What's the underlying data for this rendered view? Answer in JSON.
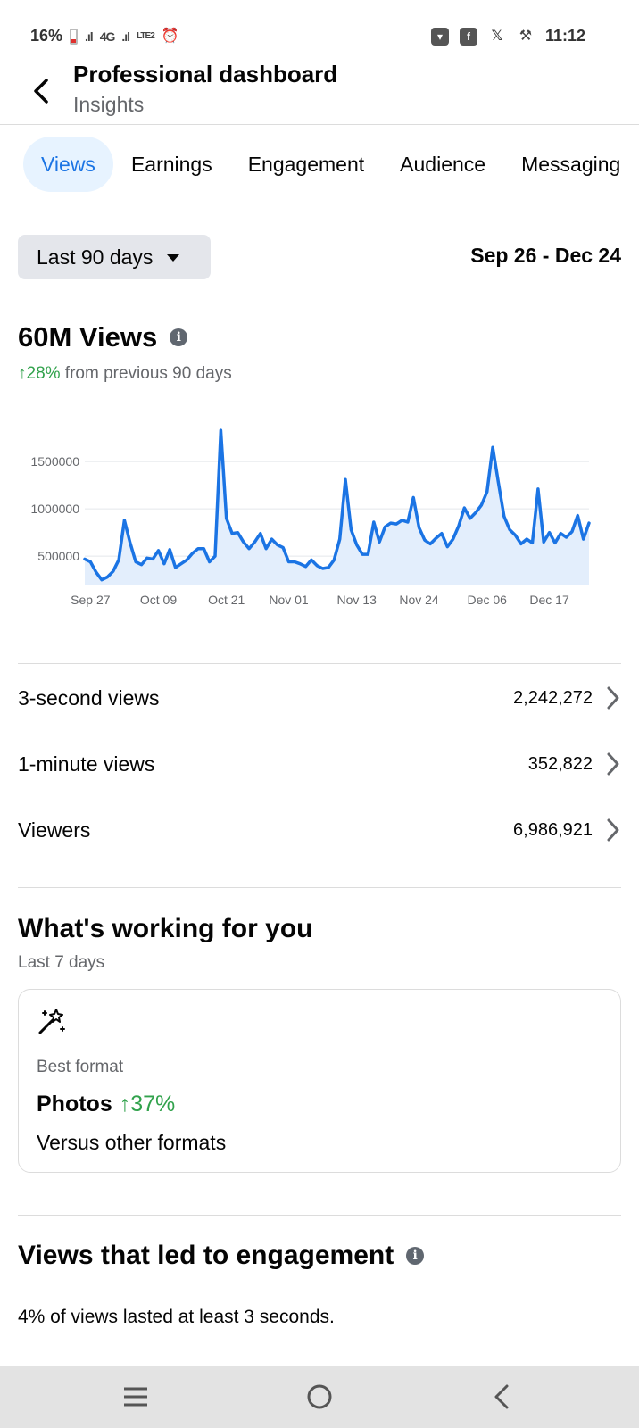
{
  "status_bar": {
    "battery": "16%",
    "network": "4G",
    "lte": "LTE2",
    "time": "11:12"
  },
  "header": {
    "title": "Professional dashboard",
    "subtitle": "Insights"
  },
  "tabs": [
    {
      "label": "Views",
      "active": true
    },
    {
      "label": "Earnings",
      "active": false
    },
    {
      "label": "Engagement",
      "active": false
    },
    {
      "label": "Audience",
      "active": false
    },
    {
      "label": "Messaging",
      "active": false
    }
  ],
  "filter": {
    "range_label": "Last 90 days",
    "date_range": "Sep 26 - Dec 24"
  },
  "summary": {
    "title": "60M Views",
    "delta_arrow": "↑",
    "delta_value": "28%",
    "delta_text": " from previous 90 days"
  },
  "chart_data": {
    "type": "area",
    "title": "",
    "xlabel": "",
    "ylabel": "",
    "ylim": [
      200000,
      1850000
    ],
    "grid": true,
    "color": "#1b74e4",
    "fill": "#e3eefc",
    "x_tick_labels": [
      "Sep 27",
      "Oct 09",
      "Oct 21",
      "Nov 01",
      "Nov 13",
      "Nov 24",
      "Dec 06",
      "Dec 17"
    ],
    "x_tick_index": [
      1,
      13,
      25,
      36,
      48,
      59,
      71,
      82
    ],
    "y_ticks": [
      500000,
      1000000,
      1500000
    ],
    "y_tick_labels": [
      "500000",
      "1000000",
      "1500000"
    ],
    "values": [
      470000,
      440000,
      330000,
      250000,
      280000,
      340000,
      460000,
      880000,
      640000,
      440000,
      410000,
      480000,
      470000,
      560000,
      420000,
      570000,
      380000,
      420000,
      460000,
      530000,
      580000,
      580000,
      440000,
      500000,
      1830000,
      900000,
      740000,
      750000,
      650000,
      580000,
      650000,
      740000,
      580000,
      680000,
      620000,
      590000,
      440000,
      440000,
      420000,
      390000,
      460000,
      400000,
      370000,
      380000,
      460000,
      680000,
      1310000,
      780000,
      620000,
      520000,
      520000,
      860000,
      650000,
      810000,
      850000,
      840000,
      880000,
      860000,
      1120000,
      800000,
      670000,
      630000,
      690000,
      740000,
      600000,
      680000,
      820000,
      1010000,
      900000,
      960000,
      1040000,
      1180000,
      1650000,
      1280000,
      920000,
      780000,
      720000,
      630000,
      680000,
      640000,
      1210000,
      650000,
      750000,
      640000,
      740000,
      700000,
      760000,
      930000,
      680000,
      850000
    ]
  },
  "metrics": [
    {
      "label": "3-second views",
      "value": "2,242,272"
    },
    {
      "label": "1-minute views",
      "value": "352,822"
    },
    {
      "label": "Viewers",
      "value": "6,986,921"
    }
  ],
  "working": {
    "title": "What's working for you",
    "subtitle": "Last 7 days",
    "card": {
      "icon": "magic-wand-icon",
      "label": "Best format",
      "format": "Photos",
      "pct": "↑37%",
      "footer": "Versus other formats"
    }
  },
  "engagement": {
    "title": "Views that led to engagement",
    "text": "4% of views lasted at least 3 seconds."
  },
  "nav": {
    "icons": [
      "menu-icon",
      "home-icon",
      "back-icon"
    ]
  }
}
